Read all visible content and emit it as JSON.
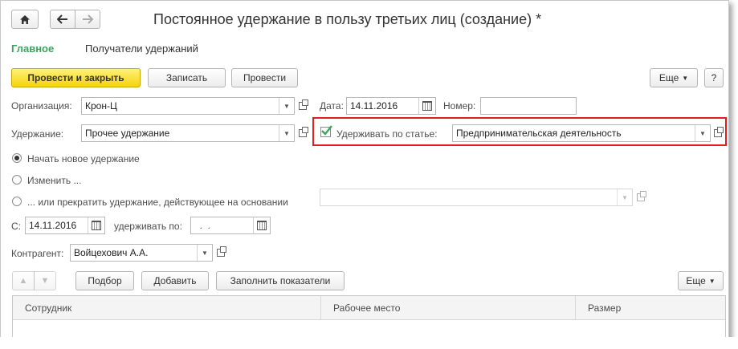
{
  "window": {
    "title": "Постоянное удержание в пользу третьих лиц (создание) *"
  },
  "nav": {
    "tabs": [
      {
        "label": "Главное",
        "active": true
      },
      {
        "label": "Получатели удержаний",
        "active": false
      }
    ]
  },
  "toolbar": {
    "post_close_label": "Провести и закрыть",
    "save_label": "Записать",
    "post_label": "Провести",
    "more_label": "Еще",
    "help_label": "?"
  },
  "form": {
    "organization_label": "Организация:",
    "organization_value": "Крон-Ц",
    "date_label": "Дата:",
    "date_value": "14.11.2016",
    "number_label": "Номер:",
    "number_value": "",
    "deduction_label": "Удержание:",
    "deduction_value": "Прочее удержание",
    "by_article_label": "Удерживать по статье:",
    "by_article_checked": true,
    "article_value": "Предпринимательская деятельность",
    "radio_options": [
      {
        "label": "Начать новое удержание",
        "selected": true
      },
      {
        "label": "Изменить ...",
        "selected": false
      },
      {
        "label": "... или прекратить удержание, действующее на основании",
        "selected": false
      }
    ],
    "basis_value": "",
    "from_label": "С:",
    "from_value": "14.11.2016",
    "until_label": "удерживать по:",
    "until_value": "  .  .",
    "counterparty_label": "Контрагент:",
    "counterparty_value": "Войцехович А.А."
  },
  "table_toolbar": {
    "pick_label": "Подбор",
    "add_label": "Добавить",
    "fill_label": "Заполнить показатели",
    "more_label": "Еще"
  },
  "table": {
    "columns": [
      "Сотрудник",
      "Рабочее место",
      "Размер"
    ]
  },
  "colors": {
    "accent_green": "#3aa55d",
    "primary_yellow": "#f5d30c",
    "highlight_red": "#e02020"
  }
}
